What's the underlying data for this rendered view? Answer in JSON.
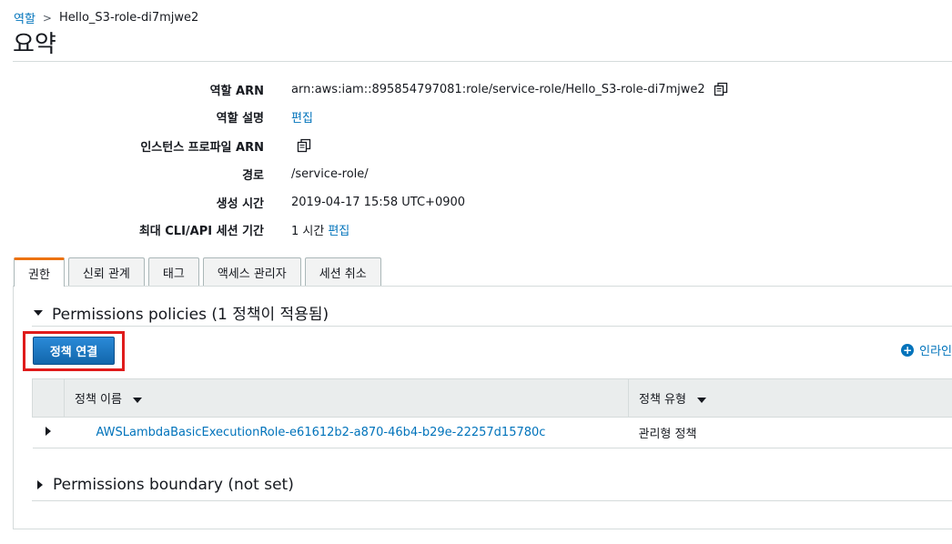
{
  "breadcrumb": {
    "parent": "역할",
    "separator": ">",
    "current": "Hello_S3-role-di7mjwe2"
  },
  "page_title": "요약",
  "summary": {
    "rows": [
      {
        "label": "역할 ARN",
        "value": "arn:aws:iam::895854797081:role/service-role/Hello_S3-role-di7mjwe2"
      },
      {
        "label": "역할 설명",
        "value": "편집"
      },
      {
        "label": "인스턴스 프로파일 ARN",
        "value": ""
      },
      {
        "label": "경로",
        "value": "/service-role/"
      },
      {
        "label": "생성 시간",
        "value": "2019-04-17 15:58 UTC+0900"
      },
      {
        "label": "최대 CLI/API 세션 기간",
        "value": "1 시간",
        "link": "편집"
      }
    ]
  },
  "tabs": [
    {
      "label": "권한",
      "active": true
    },
    {
      "label": "신뢰 관계"
    },
    {
      "label": "태그"
    },
    {
      "label": "액세스 관리자"
    },
    {
      "label": "세션 취소"
    }
  ],
  "permissions_section": {
    "title": "Permissions policies (1 정책이 적용됨)",
    "attach_button": "정책 연결",
    "inline_add": "인라인",
    "table": {
      "headers": [
        "정책 이름",
        "정책 유형"
      ],
      "rows": [
        {
          "name": "AWSLambdaBasicExecutionRole-e61612b2-a870-46b4-b29e-22257d15780c",
          "type": "관리형 정책"
        }
      ]
    }
  },
  "boundary_section": {
    "title": "Permissions boundary (not set)"
  },
  "colors": {
    "link": "#0073bb",
    "active_tab_accent": "#ec7211",
    "primary_button": "#1a73c2",
    "highlight": "#df1b1b"
  }
}
